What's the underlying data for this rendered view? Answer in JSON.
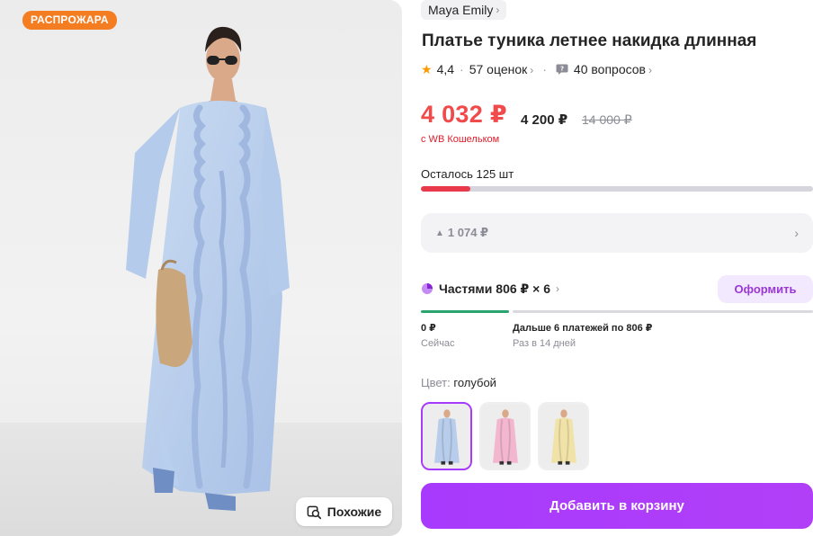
{
  "photo": {
    "badge": "РАСПРОЖАРА",
    "similar_label": "Похожие",
    "similar_icon": "search-similar-icon"
  },
  "product": {
    "brand": "Maya Emily",
    "title": "Платье туника летнее накидка длинная",
    "rating": "4,4",
    "reviews": "57 оценок",
    "questions": "40 вопросов"
  },
  "prices": {
    "wallet_price": "4 032 ₽",
    "regular_price": "4 200 ₽",
    "old_price": "14 000 ₽",
    "wallet_note": "с WB Кошельком",
    "price_color": "#f14a4a"
  },
  "stock": {
    "label": "Осталось 125 шт",
    "fill_fraction": 0.125
  },
  "price_drop": {
    "amount": "1 074 ₽"
  },
  "installments": {
    "label": "Частями 806 ₽ × 6",
    "checkout_label": "Оформить",
    "now_amount": "0 ₽",
    "now_label": "Сейчас",
    "later_amount": "Дальше 6 платежей по 806 ₽",
    "later_label": "Раз в 14 дней"
  },
  "color": {
    "label": "Цвет:",
    "value": "голубой",
    "options": [
      {
        "name": "голубой",
        "tint": "#b7cdeb",
        "selected": true
      },
      {
        "name": "розовый",
        "tint": "#f3b6cf",
        "selected": false
      },
      {
        "name": "жёлтый",
        "tint": "#f1e3a8",
        "selected": false
      }
    ]
  },
  "actions": {
    "add_to_cart": "Добавить в корзину"
  },
  "colors": {
    "accent": "#a73afd",
    "badge": "#f47c21",
    "stock_fill": "#e83a4a",
    "plan_now": "#2aa36f"
  }
}
